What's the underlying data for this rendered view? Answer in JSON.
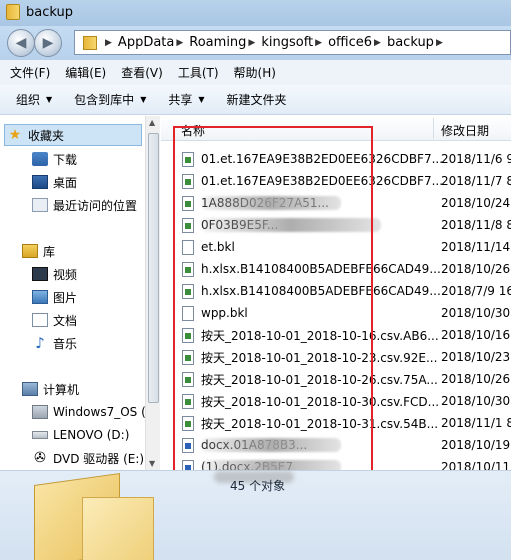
{
  "window": {
    "title": "backup"
  },
  "nav": {
    "back_glyph": "◀",
    "forward_glyph": "▶",
    "breadcrumbs": [
      "AppData",
      "Roaming",
      "kingsoft",
      "office6",
      "backup"
    ]
  },
  "menu": [
    "文件(F)",
    "编辑(E)",
    "查看(V)",
    "工具(T)",
    "帮助(H)"
  ],
  "commands": [
    {
      "label": "组织",
      "dropdown": true
    },
    {
      "label": "包含到库中",
      "dropdown": true
    },
    {
      "label": "共享",
      "dropdown": true
    },
    {
      "label": "新建文件夹",
      "dropdown": false
    }
  ],
  "sidebar": {
    "favorites": {
      "label": "收藏夹",
      "items": [
        "下载",
        "桌面",
        "最近访问的位置"
      ]
    },
    "libraries": {
      "label": "库",
      "items": [
        "视频",
        "图片",
        "文档",
        "音乐"
      ]
    },
    "computer": {
      "label": "计算机",
      "items": [
        "Windows7_OS (",
        "LENOVO (D:)",
        "DVD 驱动器 (E:)"
      ]
    }
  },
  "columns": {
    "name": "名称",
    "date": "修改日期"
  },
  "files": [
    {
      "name": "01.et.167EA9E38B2ED0EE6326CDBF7...",
      "date": "2018/11/6 9",
      "icon": "xl",
      "blur": false
    },
    {
      "name": "01.et.167EA9E38B2ED0EE6326CDBF7...",
      "date": "2018/11/7 8",
      "icon": "xl",
      "blur": false
    },
    {
      "name": "1A888D026F27A51...",
      "date": "2018/10/24",
      "icon": "xl",
      "blur": true
    },
    {
      "name": "0F03B9E5F...",
      "date": "2018/11/8 8",
      "icon": "xl",
      "blur": true
    },
    {
      "name": "et.bkl",
      "date": "2018/11/14",
      "icon": "plain",
      "blur": false
    },
    {
      "name": "h.xlsx.B14108400B5ADEBFE66CAD49...",
      "date": "2018/10/26",
      "icon": "xl",
      "blur": false
    },
    {
      "name": "h.xlsx.B14108400B5ADEBFE66CAD49...",
      "date": "2018/7/9 16",
      "icon": "xl",
      "blur": false
    },
    {
      "name": "wpp.bkl",
      "date": "2018/10/30",
      "icon": "plain",
      "blur": false
    },
    {
      "name": "按天_2018-10-01_2018-10-16.csv.AB6...",
      "date": "2018/10/16",
      "icon": "xl",
      "blur": false
    },
    {
      "name": "按天_2018-10-01_2018-10-23.csv.92E...",
      "date": "2018/10/23",
      "icon": "xl",
      "blur": false
    },
    {
      "name": "按天_2018-10-01_2018-10-26.csv.75A...",
      "date": "2018/10/26",
      "icon": "xl",
      "blur": false
    },
    {
      "name": "按天_2018-10-01_2018-10-30.csv.FCD...",
      "date": "2018/10/30",
      "icon": "xl",
      "blur": false
    },
    {
      "name": "按天_2018-10-01_2018-10-31.csv.54B...",
      "date": "2018/11/1 8",
      "icon": "xl",
      "blur": false
    },
    {
      "name": "docx.01A878B3...",
      "date": "2018/10/19",
      "icon": "wd",
      "blur": true
    },
    {
      "name": "(1).docx.2B5E7",
      "date": "2018/10/11",
      "icon": "wd",
      "blur": true
    }
  ],
  "status": {
    "count": "45 个对象"
  },
  "colors": {
    "highlight": "#e0242a",
    "selection": "#cde4f7",
    "titlebar": "#b8d2eb"
  }
}
